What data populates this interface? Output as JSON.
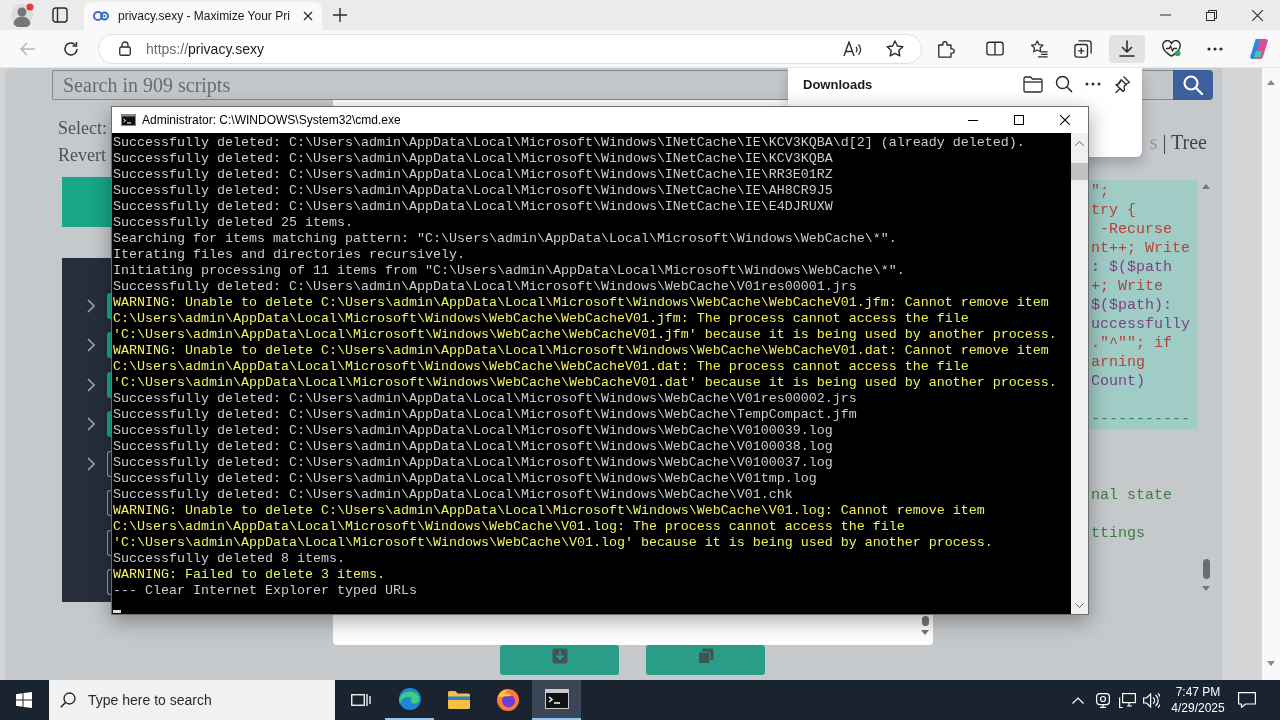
{
  "browser": {
    "tab": {
      "title": "privacy.sexy - Maximize Your Pri",
      "selected": true
    },
    "back": {
      "disabled": true
    },
    "address": {
      "scheme": "https://",
      "host": "privacy.sexy"
    },
    "toolbar_buttons": [
      {
        "kind": "extensions",
        "selected": false
      },
      {
        "kind": "split_screen",
        "selected": false
      },
      {
        "kind": "favorites",
        "selected": false
      },
      {
        "kind": "collections",
        "selected": false
      },
      {
        "kind": "downloads",
        "selected": true
      },
      {
        "kind": "essentials",
        "selected": false
      },
      {
        "kind": "more",
        "selected": false
      },
      {
        "kind": "copilot",
        "selected": false
      }
    ]
  },
  "page": {
    "search": {
      "placeholder": "Search in 909 scripts"
    },
    "select_label": "Select:",
    "revert_label": "Revert",
    "script_rows": [
      {
        "kind": "category",
        "checked": true
      },
      {
        "kind": "category",
        "checked": true
      },
      {
        "kind": "category",
        "checked": true
      },
      {
        "kind": "category",
        "checked": true
      },
      {
        "kind": "category",
        "checked": false
      },
      {
        "kind": "script",
        "checked": false
      },
      {
        "kind": "script",
        "checked": false
      },
      {
        "kind": "script",
        "checked": false
      }
    ],
    "view_switch": [
      "s",
      "| Tree"
    ],
    "code_lines": [
      {
        "kind": "code",
        "text": "\";"
      },
      {
        "kind": "code",
        "text": "try {"
      },
      {
        "kind": "code",
        "text": " -Recurse"
      },
      {
        "kind": "code",
        "text": "nt++; Write"
      },
      {
        "kind": "variable",
        "text": ": $($path"
      },
      {
        "kind": "code",
        "text": "+; Write"
      },
      {
        "kind": "variable",
        "text": "$($path):"
      },
      {
        "kind": "variable",
        "text": "uccessfully"
      },
      {
        "kind": "code",
        "text": ".\"^\"\"; if"
      },
      {
        "kind": "code",
        "text": "arning"
      },
      {
        "kind": "variable",
        "text": "Count)"
      },
      {
        "kind": "comment",
        "text": "-----------"
      }
    ],
    "fragments": [
      "nal state",
      "ttings"
    ]
  },
  "downloads_panel": {
    "title": "Downloads"
  },
  "console": {
    "title": "Administrator: C:\\WINDOWS\\System32\\cmd.exe",
    "lines": [
      {
        "kind": "info",
        "text": "Successfully deleted: C:\\Users\\admin\\AppData\\Local\\Microsoft\\Windows\\INetCache\\IE\\KCV3KQBA\\d[2] (already deleted)."
      },
      {
        "kind": "info",
        "text": "Successfully deleted: C:\\Users\\admin\\AppData\\Local\\Microsoft\\Windows\\INetCache\\IE\\KCV3KQBA"
      },
      {
        "kind": "info",
        "text": "Successfully deleted: C:\\Users\\admin\\AppData\\Local\\Microsoft\\Windows\\INetCache\\IE\\RR3E01RZ"
      },
      {
        "kind": "info",
        "text": "Successfully deleted: C:\\Users\\admin\\AppData\\Local\\Microsoft\\Windows\\INetCache\\IE\\AH8CR9J5"
      },
      {
        "kind": "info",
        "text": "Successfully deleted: C:\\Users\\admin\\AppData\\Local\\Microsoft\\Windows\\INetCache\\IE\\E4DJRUXW"
      },
      {
        "kind": "info",
        "text": "Successfully deleted 25 items."
      },
      {
        "kind": "info",
        "text": "Searching for items matching pattern: \"C:\\Users\\admin\\AppData\\Local\\Microsoft\\Windows\\WebCache\\*\"."
      },
      {
        "kind": "info",
        "text": "Iterating files and directories recursively."
      },
      {
        "kind": "info",
        "text": "Initiating processing of 11 items from \"C:\\Users\\admin\\AppData\\Local\\Microsoft\\Windows\\WebCache\\*\"."
      },
      {
        "kind": "info",
        "text": "Successfully deleted: C:\\Users\\admin\\AppData\\Local\\Microsoft\\Windows\\WebCache\\V01res00001.jrs"
      },
      {
        "kind": "warning",
        "text": "WARNING: Unable to delete C:\\Users\\admin\\AppData\\Local\\Microsoft\\Windows\\WebCache\\WebCacheV01.jfm: Cannot remove item"
      },
      {
        "kind": "warning",
        "text": "C:\\Users\\admin\\AppData\\Local\\Microsoft\\Windows\\WebCache\\WebCacheV01.jfm: The process cannot access the file"
      },
      {
        "kind": "warning",
        "text": "'C:\\Users\\admin\\AppData\\Local\\Microsoft\\Windows\\WebCache\\WebCacheV01.jfm' because it is being used by another process."
      },
      {
        "kind": "warning",
        "text": "WARNING: Unable to delete C:\\Users\\admin\\AppData\\Local\\Microsoft\\Windows\\WebCache\\WebCacheV01.dat: Cannot remove item"
      },
      {
        "kind": "warning",
        "text": "C:\\Users\\admin\\AppData\\Local\\Microsoft\\Windows\\WebCache\\WebCacheV01.dat: The process cannot access the file"
      },
      {
        "kind": "warning",
        "text": "'C:\\Users\\admin\\AppData\\Local\\Microsoft\\Windows\\WebCache\\WebCacheV01.dat' because it is being used by another process."
      },
      {
        "kind": "info",
        "text": "Successfully deleted: C:\\Users\\admin\\AppData\\Local\\Microsoft\\Windows\\WebCache\\V01res00002.jrs"
      },
      {
        "kind": "info",
        "text": "Successfully deleted: C:\\Users\\admin\\AppData\\Local\\Microsoft\\Windows\\WebCache\\TempCompact.jfm"
      },
      {
        "kind": "info",
        "text": "Successfully deleted: C:\\Users\\admin\\AppData\\Local\\Microsoft\\Windows\\WebCache\\V0100039.log"
      },
      {
        "kind": "info",
        "text": "Successfully deleted: C:\\Users\\admin\\AppData\\Local\\Microsoft\\Windows\\WebCache\\V0100038.log"
      },
      {
        "kind": "info",
        "text": "Successfully deleted: C:\\Users\\admin\\AppData\\Local\\Microsoft\\Windows\\WebCache\\V0100037.log"
      },
      {
        "kind": "info",
        "text": "Successfully deleted: C:\\Users\\admin\\AppData\\Local\\Microsoft\\Windows\\WebCache\\V01tmp.log"
      },
      {
        "kind": "info",
        "text": "Successfully deleted: C:\\Users\\admin\\AppData\\Local\\Microsoft\\Windows\\WebCache\\V01.chk"
      },
      {
        "kind": "warning",
        "text": "WARNING: Unable to delete C:\\Users\\admin\\AppData\\Local\\Microsoft\\Windows\\WebCache\\V01.log: Cannot remove item"
      },
      {
        "kind": "warning",
        "text": "C:\\Users\\admin\\AppData\\Local\\Microsoft\\Windows\\WebCache\\V01.log: The process cannot access the file"
      },
      {
        "kind": "warning",
        "text": "'C:\\Users\\admin\\AppData\\Local\\Microsoft\\Windows\\WebCache\\V01.log' because it is being used by another process."
      },
      {
        "kind": "info",
        "text": "Successfully deleted 8 items."
      },
      {
        "kind": "warning",
        "text": "WARNING: Failed to delete 3 items."
      },
      {
        "kind": "info",
        "text": "--- Clear Internet Explorer typed URLs"
      }
    ]
  },
  "taskbar": {
    "search": {
      "placeholder": "Type here to search"
    },
    "apps": [
      {
        "kind": "edge",
        "running": true,
        "selected": false
      },
      {
        "kind": "explorer",
        "running": false,
        "selected": false
      },
      {
        "kind": "firefox",
        "running": false,
        "selected": false
      },
      {
        "kind": "terminal",
        "running": true,
        "selected": true
      }
    ],
    "clock": {
      "time": "7:47 PM",
      "date": "4/29/2025"
    }
  }
}
